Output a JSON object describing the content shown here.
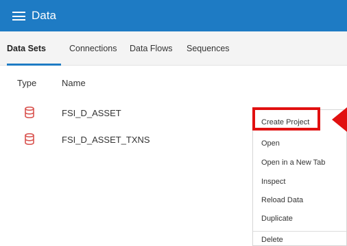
{
  "header": {
    "title": "Data"
  },
  "tabs": [
    {
      "label": "Data Sets"
    },
    {
      "label": "Connections"
    },
    {
      "label": "Data Flows"
    },
    {
      "label": "Sequences"
    }
  ],
  "table": {
    "columns": [
      "Type",
      "Name"
    ],
    "rows": [
      {
        "name": "FSI_D_ASSET",
        "icon": "database-icon"
      },
      {
        "name": "FSI_D_ASSET_TXNS",
        "icon": "database-icon"
      }
    ]
  },
  "context_menu": {
    "items": [
      "Create Project",
      "Open",
      "Open in a New Tab",
      "Inspect",
      "Reload Data",
      "Duplicate",
      "Delete"
    ]
  },
  "colors": {
    "accent": "#1e7bc4",
    "dataset_icon": "#d9534f",
    "highlight": "#e11010"
  }
}
